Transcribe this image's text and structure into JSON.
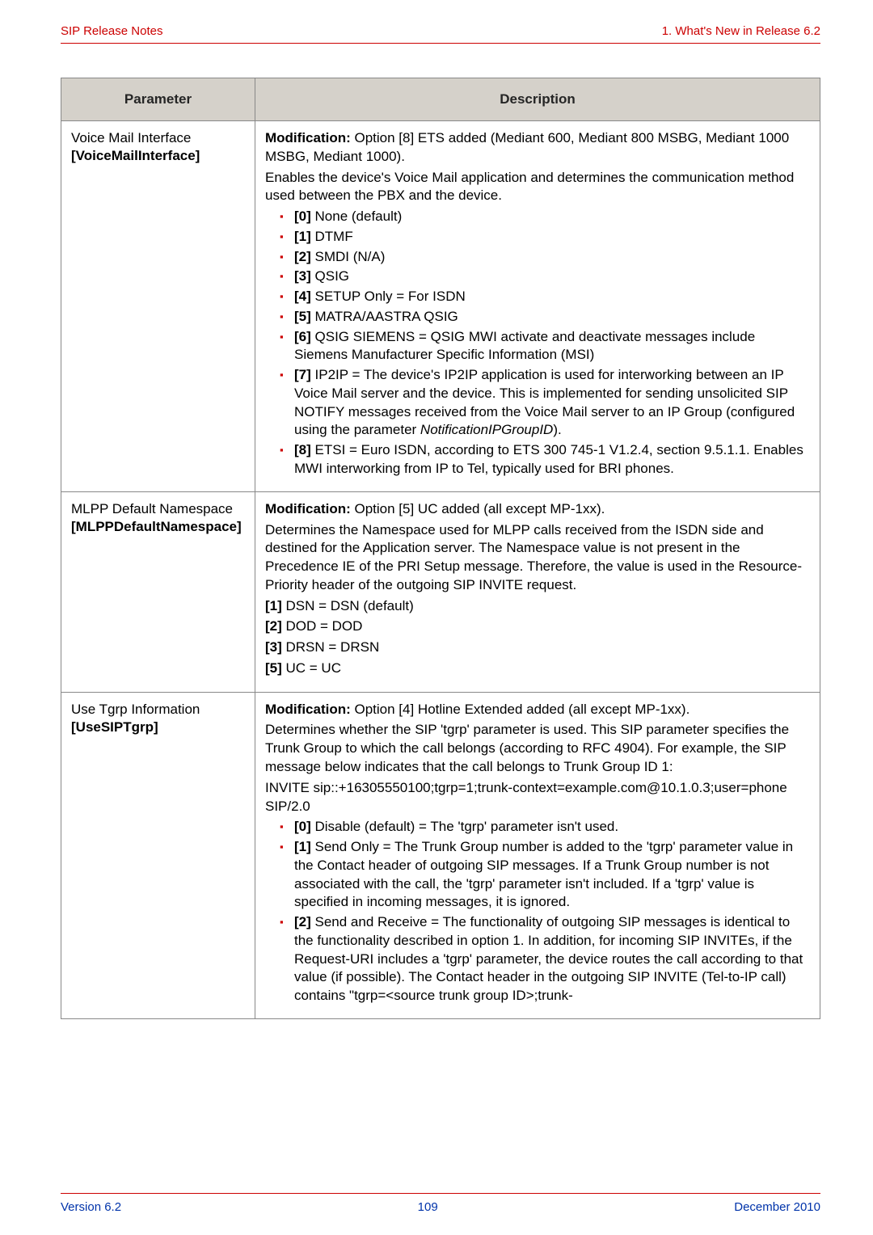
{
  "header": {
    "left": "SIP Release Notes",
    "right": "1. What's New in Release 6.2"
  },
  "table": {
    "headers": [
      "Parameter",
      "Description"
    ],
    "rows": [
      {
        "param_name": "Voice Mail Interface",
        "param_bracket": "[VoiceMailInterface]",
        "desc_mod_label": "Modification:",
        "desc_mod_rest": " Option [8] ETS added (Mediant 600, Mediant 800 MSBG, Mediant 1000 MSBG, Mediant 1000).",
        "desc_intro": "Enables the device's Voice Mail application and determines the communication method used between the PBX and the device.",
        "b0_k": "[0]",
        "b0_v": " None (default)",
        "b1_k": "[1]",
        "b1_v": " DTMF",
        "b2_k": "[2]",
        "b2_v": " SMDI (N/A)",
        "b3_k": "[3]",
        "b3_v": " QSIG",
        "b4_k": "[4]",
        "b4_v": " SETUP Only = For ISDN",
        "b5_k": "[5]",
        "b5_v": " MATRA/AASTRA QSIG",
        "b6_k": "[6]",
        "b6_v": " QSIG SIEMENS = QSIG MWI activate and deactivate messages include Siemens Manufacturer Specific Information (MSI)",
        "b7_k": "[7]",
        "b7_v": " IP2IP = The device's IP2IP application is used for interworking between an IP Voice Mail server and the device. This is implemented for sending unsolicited SIP NOTIFY messages received from the Voice Mail server to an IP Group (configured using the parameter ",
        "b7_it": "NotificationIPGroupID",
        "b7_tail": ").",
        "b8_k": "[8]",
        "b8_v": " ETSI = Euro ISDN, according to ETS 300 745-1 V1.2.4, section 9.5.1.1. Enables MWI interworking from IP to Tel, typically used for BRI phones."
      },
      {
        "param_name": "MLPP Default Namespace",
        "param_bracket": "[MLPPDefaultNamespace]",
        "desc_mod_label": "Modification:",
        "desc_mod_rest": " Option [5] UC added (all except MP-1xx).",
        "desc_intro": "Determines the Namespace used for MLPP calls received from the ISDN side and destined for the Application server. The Namespace value is not present in the Precedence IE of the PRI Setup message. Therefore, the value is used in the Resource-Priority header of the outgoing SIP INVITE request.",
        "l1_k": "[1]",
        "l1_v": " DSN = DSN (default)",
        "l2_k": "[2]",
        "l2_v": " DOD = DOD",
        "l3_k": "[3]",
        "l3_v": " DRSN = DRSN",
        "l5_k": "[5]",
        "l5_v": " UC = UC"
      },
      {
        "param_name": "Use Tgrp Information",
        "param_bracket": "[UseSIPTgrp]",
        "desc_mod_label": "Modification:",
        "desc_mod_rest": " Option [4] Hotline Extended added (all except MP-1xx).",
        "desc_intro": "Determines whether the SIP 'tgrp' parameter is used. This SIP parameter specifies the Trunk Group to which the call belongs (according to RFC 4904). For example, the SIP message below indicates that the call belongs to Trunk Group ID 1:",
        "code1": "INVITE sip::+16305550100;tgrp=1;trunk-context=example.com@10.1.0.3;user=phone SIP/2.0",
        "b0_k": "[0]",
        "b0_v": " Disable (default) = The 'tgrp' parameter isn't used.",
        "b1_k": "[1]",
        "b1_v": " Send Only = The Trunk Group number is added to the 'tgrp' parameter value in the Contact header of outgoing SIP messages. If a Trunk Group number is not associated with the call, the 'tgrp' parameter isn't included. If a 'tgrp' value is specified in incoming messages, it is ignored.",
        "b2_k": "[2]",
        "b2_v": " Send and Receive = The functionality of outgoing SIP messages is identical to the functionality described in option 1. In addition, for incoming SIP INVITEs, if the Request-URI includes a 'tgrp' parameter, the device routes the call according to that value (if possible). The Contact header in the outgoing SIP INVITE (Tel-to-IP call) contains   \"tgrp=<source trunk group ID>;trunk-"
      }
    ]
  },
  "footer": {
    "left": "Version 6.2",
    "center": "109",
    "right": "December 2010"
  }
}
